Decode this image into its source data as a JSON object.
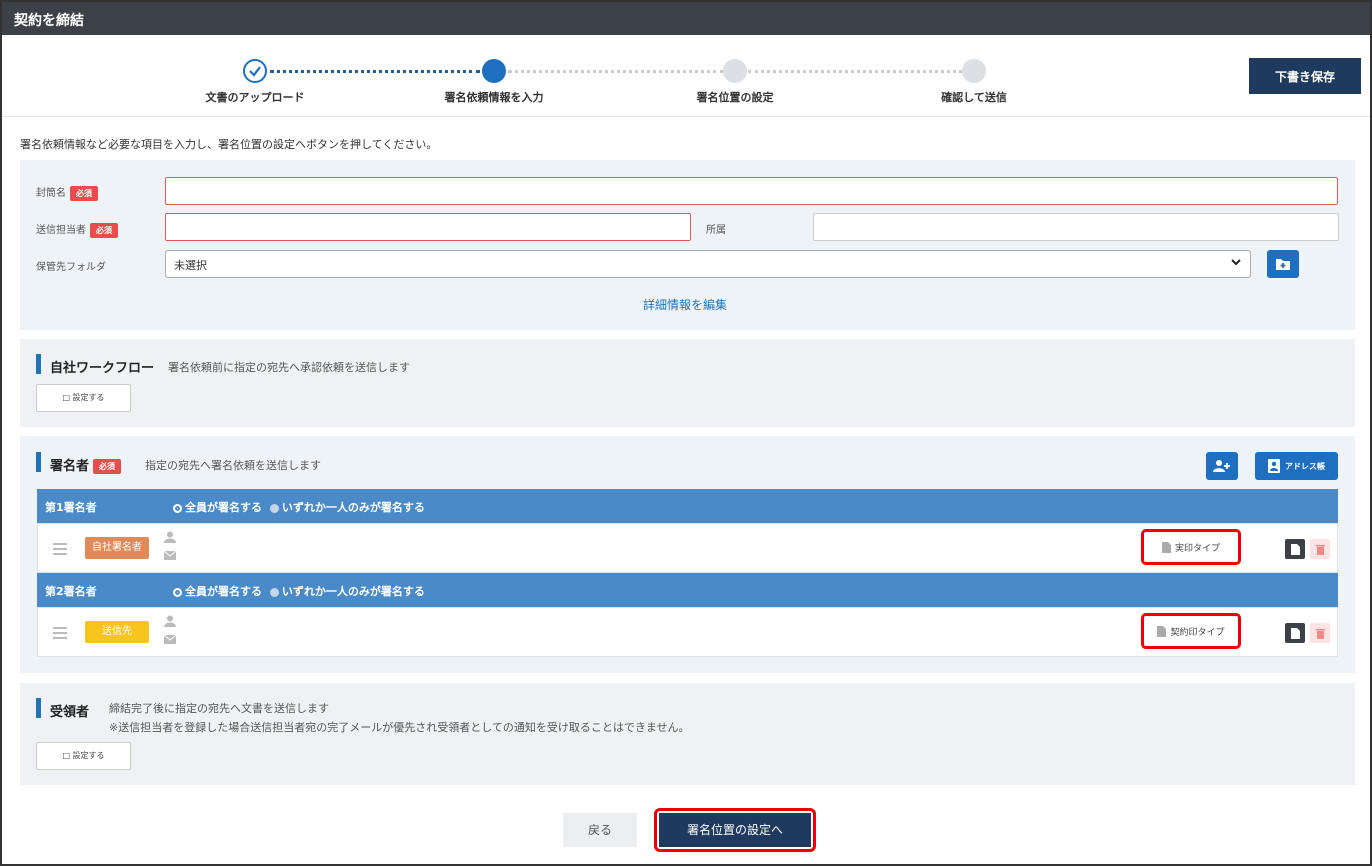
{
  "window": {
    "title": "契約を締結"
  },
  "stepper": {
    "steps": [
      {
        "label": "文書のアップロード",
        "state": "done"
      },
      {
        "label": "署名依頼情報を入力",
        "state": "current"
      },
      {
        "label": "署名位置の設定",
        "state": "pending"
      },
      {
        "label": "確認して送信",
        "state": "pending"
      }
    ]
  },
  "draft_save_label": "下書き保存",
  "instruction": "署名依頼情報など必要な項目を入力し、署名位置の設定へボタンを押してください。",
  "required_badge": "必須",
  "form": {
    "envelope_label": "封筒名",
    "envelope_value": "",
    "sender_label": "送信担当者",
    "sender_value": "",
    "affiliation_label": "所属",
    "affiliation_value": "",
    "folder_label": "保管先フォルダ",
    "folder_selected": "未選択",
    "edit_details_link": "詳細情報を編集"
  },
  "workflow": {
    "title": "自社ワークフロー",
    "desc": "署名依頼前に指定の宛先へ承認依頼を送信します",
    "button": "□ 設定する"
  },
  "signers": {
    "title": "署名者",
    "desc": "指定の宛先へ署名依頼を送信します",
    "address_book_label": "アドレス帳",
    "option_all": "全員が署名する",
    "option_any": "いずれか一人のみが署名する",
    "rows": [
      {
        "header": "第1署名者",
        "tag": "自社署名者",
        "type": "実印タイプ"
      },
      {
        "header": "第2署名者",
        "tag": "送信先",
        "type": "契約印タイプ"
      }
    ]
  },
  "recipients": {
    "title": "受領者",
    "desc": "締結完了後に指定の宛先へ文書を送信します",
    "note": "※送信担当者を登録した場合送信担当者宛の完了メールが優先され受領者としての通知を受け取ることはできません。",
    "button": "□ 設定する"
  },
  "footer": {
    "back_label": "戻る",
    "next_label": "署名位置の設定へ"
  },
  "colors": {
    "primary": "#1e3a5f",
    "accent": "#1f73b7",
    "row_header": "#4a8ac9",
    "required": "#e84d4d",
    "tag_internal": "#e08a5a",
    "tag_recipient": "#f7c51e",
    "highlight": "#ee0000"
  }
}
